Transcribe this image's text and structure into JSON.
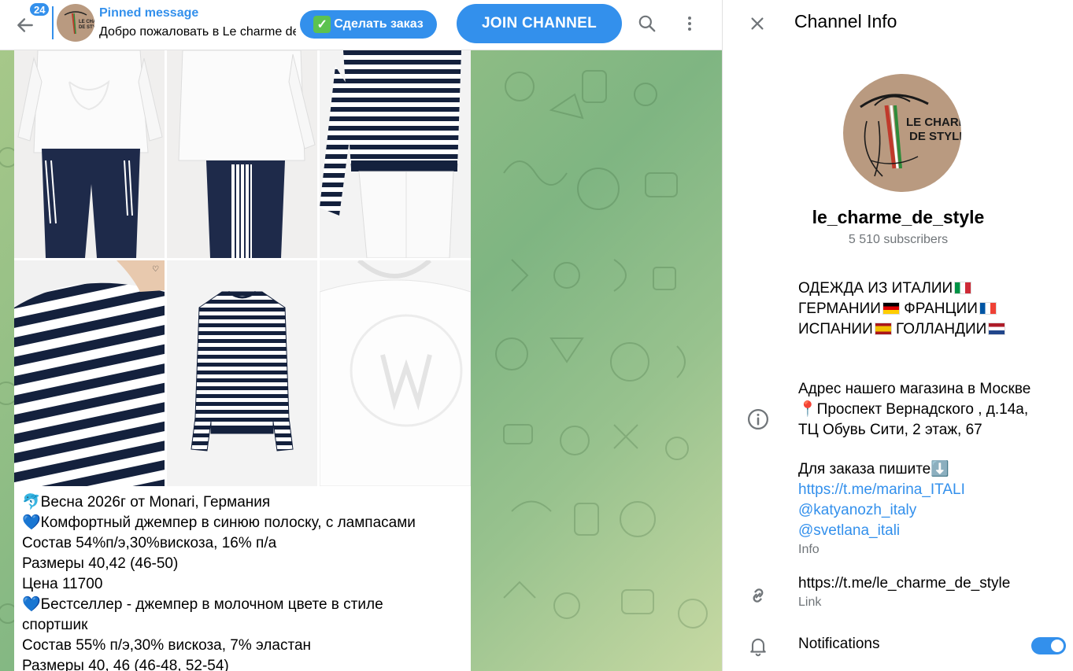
{
  "topbar": {
    "unread_count": "24",
    "pinned_title": "Pinned message",
    "pinned_text": "Добро пожаловать в Le charme de ...",
    "order_button": "Сделать заказ",
    "join_button": "JOIN CHANNEL",
    "icons": [
      "back-arrow-icon",
      "search-icon",
      "more-vertical-icon"
    ]
  },
  "message": {
    "photos": [
      "white-top-navy-pants",
      "white-top-side-stripe",
      "striped-sweater-back",
      "striped-sweater-closeup",
      "striped-sweater-flat",
      "white-sweatshirt-closeup"
    ],
    "caption": [
      "🐬Весна 2026г от Monari, Германия",
      "💙Комфортный джемпер в синюю полоску, с лампасами",
      "Состав 54%п/э,30%вискоза, 16% п/а",
      "Размеры 40,42 (46-50)",
      "Цена 11700",
      "💙Бестселлер - джемпер в молочном цвете в стиле",
      "спортшик",
      "Состав 55% п/э,30% вискоза, 7% эластан",
      "Размеры 40, 46 (46-48, 52-54)"
    ]
  },
  "info": {
    "title": "Channel Info",
    "avatar_text_1": "LE CHARME",
    "avatar_text_2": "DE STYLE",
    "channel_name": "le_charme_de_style",
    "subscribers": "5 510 subscribers",
    "description": [
      "ОДЕЖДА ИЗ ИТАЛИИ",
      "ГЕРМАНИИ",
      "ФРАНЦИИ",
      "ИСПАНИИ",
      "ГОЛЛАНДИИ"
    ],
    "about": {
      "address_1": "Адрес нашего магазина в Москве",
      "address_2": "📍Проспект Вернадского , д.14а,",
      "address_3": "ТЦ Обувь Сити, 2 этаж, 67",
      "order_line": "Для заказа пишите⬇️",
      "links": [
        "https://t.me/marina_ITALI",
        "@katyanozh_italy",
        "@svetlana_itali"
      ],
      "label": "Info"
    },
    "link": {
      "value": "https://t.me/le_charme_de_style",
      "label": "Link"
    },
    "notifications": {
      "label": "Notifications",
      "enabled": true
    },
    "icons": [
      "close-icon",
      "info-icon",
      "link-icon",
      "bell-icon"
    ]
  },
  "colors": {
    "accent": "#3390ec",
    "muted": "#707579",
    "chat_bg": "#8fbd85"
  }
}
